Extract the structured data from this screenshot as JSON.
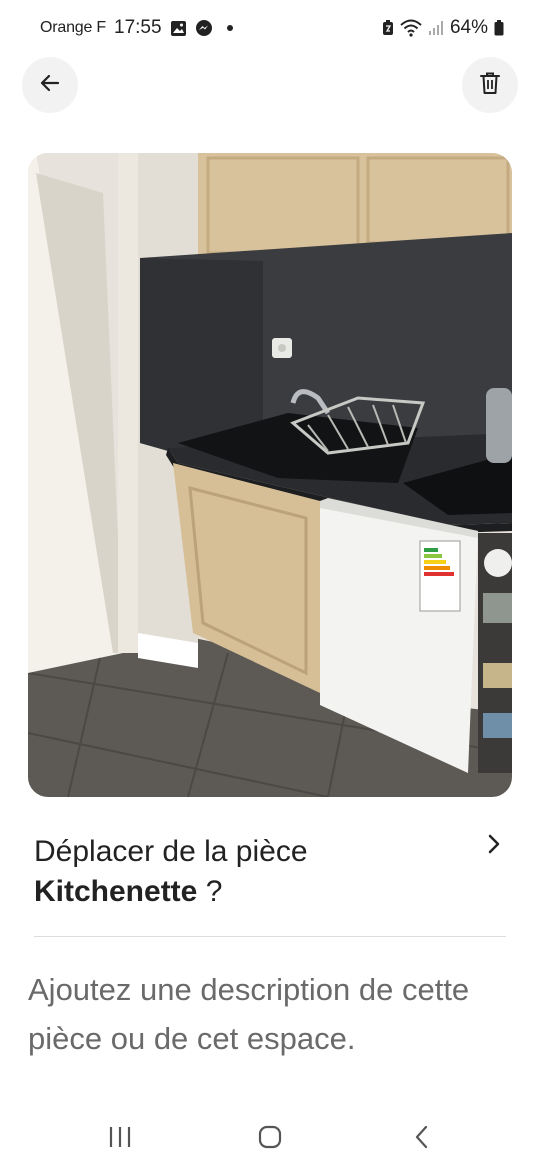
{
  "status_bar": {
    "carrier": "Orange F",
    "time": "17:55",
    "battery": "64%",
    "icons": [
      "gallery-icon",
      "messenger-icon",
      "dot-icon",
      "nfc-icon",
      "wifi-icon",
      "signal-icon",
      "battery-icon"
    ]
  },
  "header": {
    "back_icon": "arrow-left-icon",
    "delete_icon": "trash-icon"
  },
  "photo": {
    "subject": "kitchenette"
  },
  "move_room": {
    "line1": "Déplacer de la pièce",
    "room_name": "Kitchenette",
    "suffix": " ?",
    "icon": "chevron-right-icon"
  },
  "description": {
    "placeholder": "Ajoutez une description de cette pièce ou de cet espace."
  },
  "nav_bar": {
    "icons": [
      "recent-apps-icon",
      "home-icon",
      "back-icon"
    ]
  },
  "colors": {
    "text": "#222222",
    "muted": "#6a6a6a",
    "button_bg": "#f2f2f2",
    "divider": "#dddddd"
  }
}
